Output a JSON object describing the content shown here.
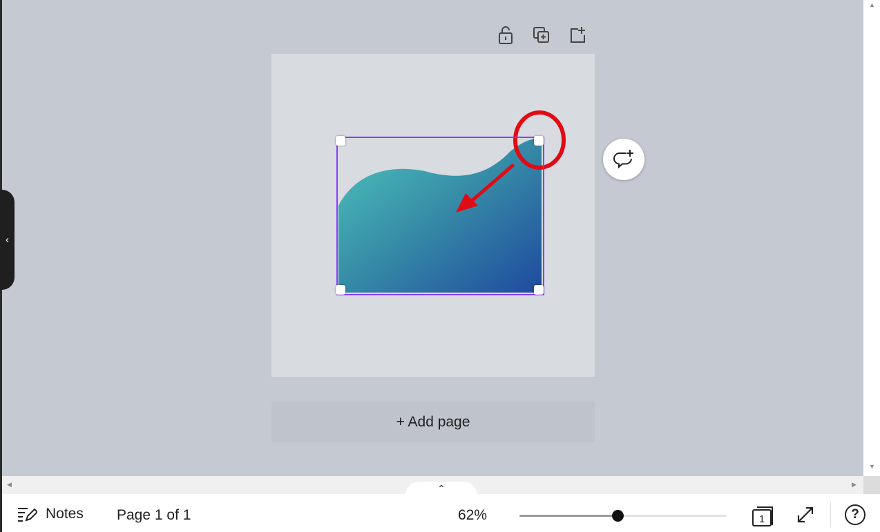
{
  "toolbar": {
    "lock_icon": "lock-open-icon",
    "duplicate_icon": "duplicate-page-icon",
    "add_icon": "add-page-icon"
  },
  "canvas": {
    "page_background": "#d8dbe0",
    "selection_color": "#8b3dff",
    "shape": {
      "gradient_start": "#4ec4bd",
      "gradient_end": "#1f4a9e"
    },
    "annotation_color": "#e10b14"
  },
  "add_page": {
    "label": "+ Add page"
  },
  "footer": {
    "notes_label": "Notes",
    "page_indicator": "Page 1 of 1",
    "zoom_label": "62%",
    "zoom_level": 0.62,
    "page_count_badge": "1",
    "help_label": "?"
  }
}
